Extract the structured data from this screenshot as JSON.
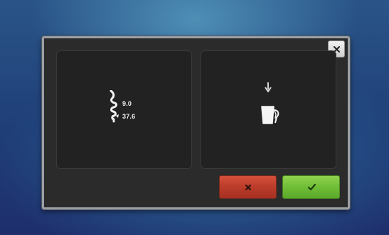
{
  "colors": {
    "background": "#25508a",
    "dialog": "#2b2b2b",
    "panel": "#222222",
    "cancel": "#c0432f",
    "confirm": "#74c43a",
    "icon": "#f2f2f2"
  },
  "dialog": {
    "close_icon": "close-icon",
    "left_panel": {
      "icon": "grinder-icon",
      "grind_value": "9.0",
      "amount_value": "37.6"
    },
    "right_panel": {
      "arrow_icon": "arrow-down-icon",
      "cup_icon": "milk-jug-icon"
    },
    "cancel_icon": "x-icon",
    "confirm_icon": "check-icon"
  }
}
